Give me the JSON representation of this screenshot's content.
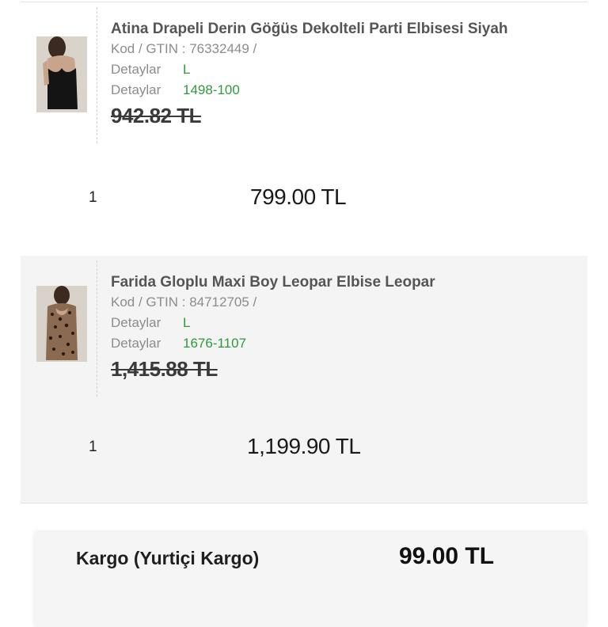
{
  "items": [
    {
      "title": "Atina Drapeli Derin Göğüs Dekolteli Parti Elbisesi Siyah",
      "code": "Kod / GTIN : 76332449 /",
      "detail1_label": "Detaylar",
      "detail1_value": "L",
      "detail2_label": "Detaylar",
      "detail2_value": "1498-100",
      "old_price": "942.82 TL",
      "quantity": "1",
      "price": "799.00 TL"
    },
    {
      "title": "Farida Gloplu Maxi Boy Leopar Elbise Leopar",
      "code": "Kod / GTIN : 84712705 /",
      "detail1_label": "Detaylar",
      "detail1_value": "L",
      "detail2_label": "Detaylar",
      "detail2_value": "1676-1107",
      "old_price": "1,415.88 TL",
      "quantity": "1",
      "price": "1,199.90 TL"
    }
  ],
  "summary": {
    "shipping_label": "Kargo (Yurtiçi Kargo)",
    "shipping_value": "99.00 TL"
  },
  "colors": {
    "detail_value": "#2e9a3a",
    "second_item_bg": "#f4f4f4"
  }
}
